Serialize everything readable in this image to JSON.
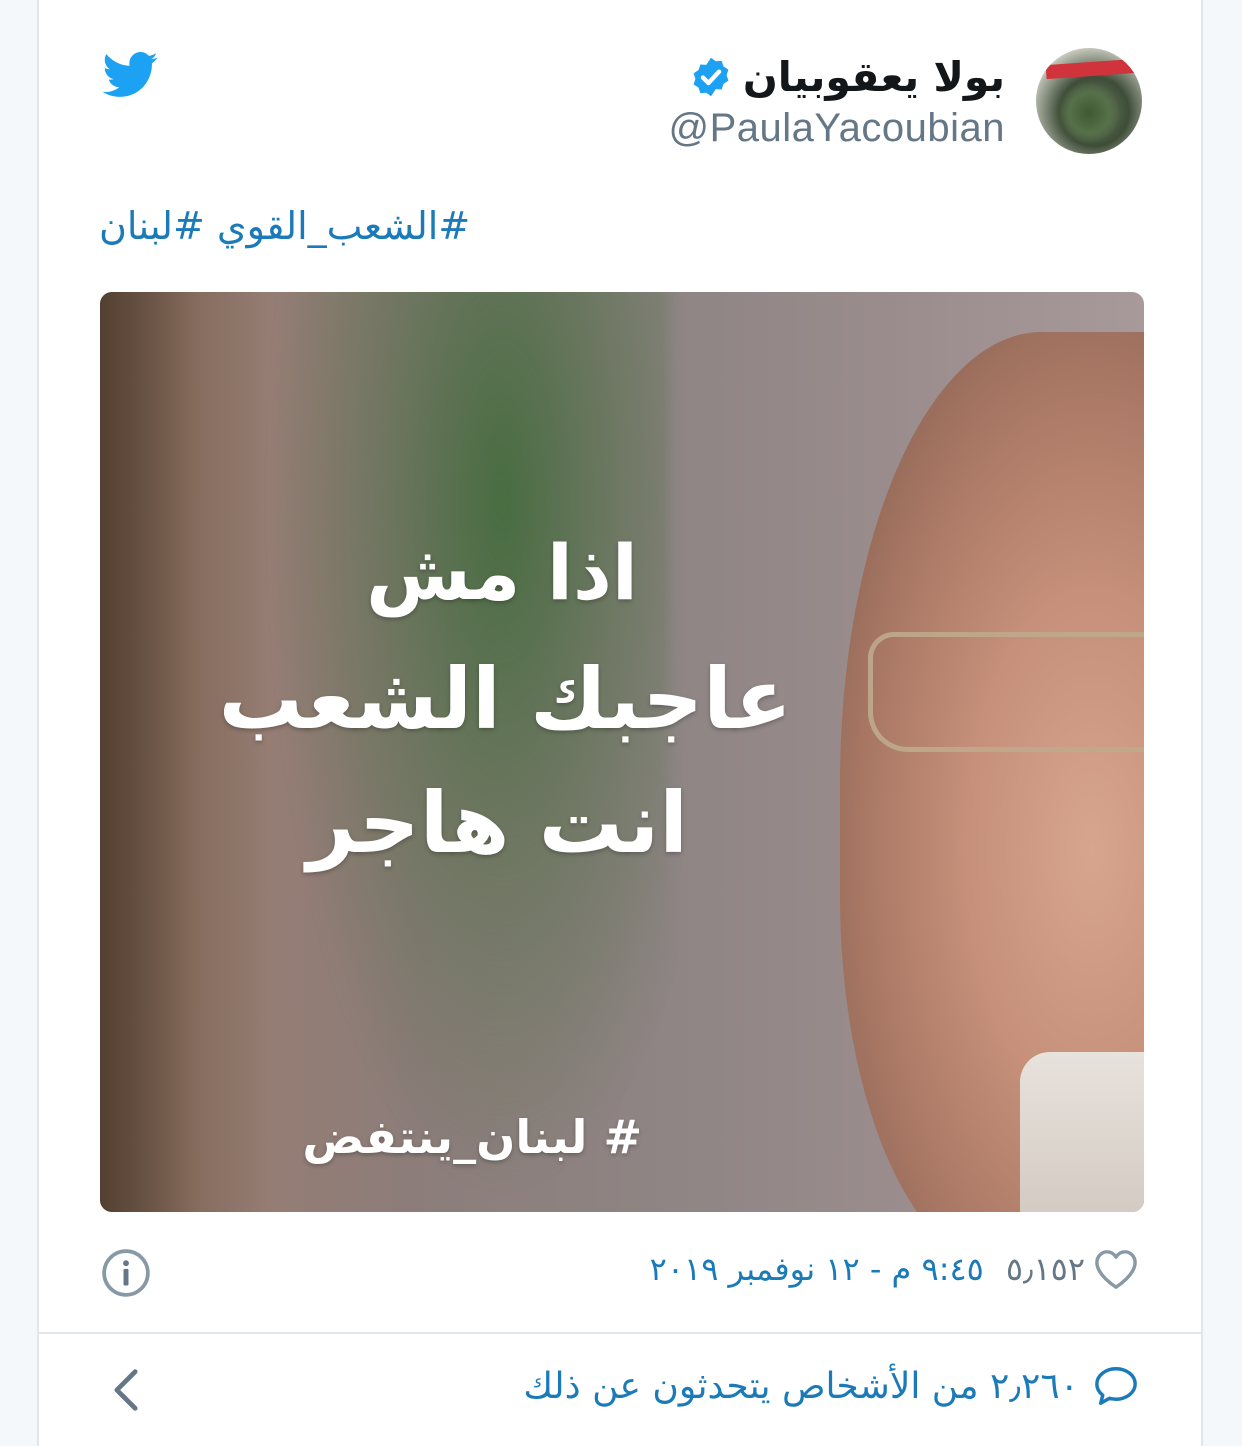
{
  "author": {
    "name": "بولا يعقوبيان",
    "handle": "@PaulaYacoubian",
    "verified": true
  },
  "tweet": {
    "text": "#الشعب_القوي #لبنان",
    "image_overlay": {
      "line1": "اذا مش",
      "line2": "عاجبك الشعب",
      "line3": "انت هاجر",
      "hashtag": "# لبنان_ينتفض"
    }
  },
  "meta": {
    "like_count": "٥٫١٥٢",
    "datetime": "٩:٤٥ م - ١٢ نوفمبر ٢٠١٩"
  },
  "footer": {
    "talking_text": "٢٫٢٦٠ من الأشخاص يتحدثون عن ذلك"
  },
  "colors": {
    "link_blue": "#1b7ab8",
    "twitter_blue": "#1da1f2",
    "muted_gray": "#657786",
    "border": "#e1e8ed"
  },
  "icons": [
    "twitter-bird-icon",
    "verified-badge-icon",
    "info-icon",
    "heart-icon",
    "chevron-left-icon",
    "speech-bubble-icon"
  ]
}
